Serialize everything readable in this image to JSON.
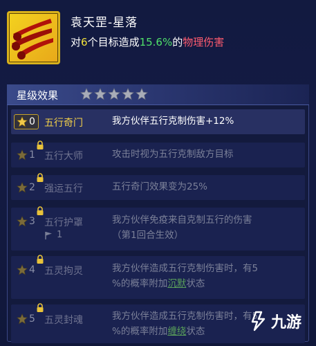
{
  "skill": {
    "name": "袁天罡-星落",
    "desc_prefix": "对",
    "target_count": "6",
    "desc_mid": "个目标造成",
    "damage_pct": "15.6%",
    "desc_of": "的",
    "damage_type": "物理伤害",
    "icon": "meteor-icon"
  },
  "star_section": {
    "title": "星级效果",
    "star_count": 5
  },
  "tiers": [
    {
      "num": "0",
      "name": "五行奇门",
      "line1": "我方伙伴五行克制伤害+12%",
      "line2": ""
    },
    {
      "num": "1",
      "name": "五行大师",
      "line1": "攻击时视为五行克制敌方目标",
      "line2": ""
    },
    {
      "num": "2",
      "name": "强运五行",
      "line1": "五行奇门效果变为25%",
      "line2": ""
    },
    {
      "num": "3",
      "name": "五行护罩",
      "line1": "我方伙伴免疫来自克制五行的伤害",
      "line2": "（第1回合生效）",
      "flag": "1"
    },
    {
      "num": "4",
      "name": "五灵拘灵",
      "line1": "我方伙伴造成五行克制伤害时，有5",
      "line2_pre": "%的概率附加",
      "line2_link": "沉默",
      "line2_post": "状态"
    },
    {
      "num": "5",
      "name": "五灵封魂",
      "line1": "我方伙伴造成五行克制伤害时，有5",
      "line2_pre": "%的概率附加",
      "line2_link": "缠绕",
      "line2_post": "状态"
    }
  ],
  "watermark": {
    "text": "九游"
  },
  "colors": {
    "highlight_yellow": "#f2e23a",
    "highlight_green": "#4fe06a",
    "damage_red": "#ff5b6f",
    "active_gold": "#f2cf49"
  }
}
